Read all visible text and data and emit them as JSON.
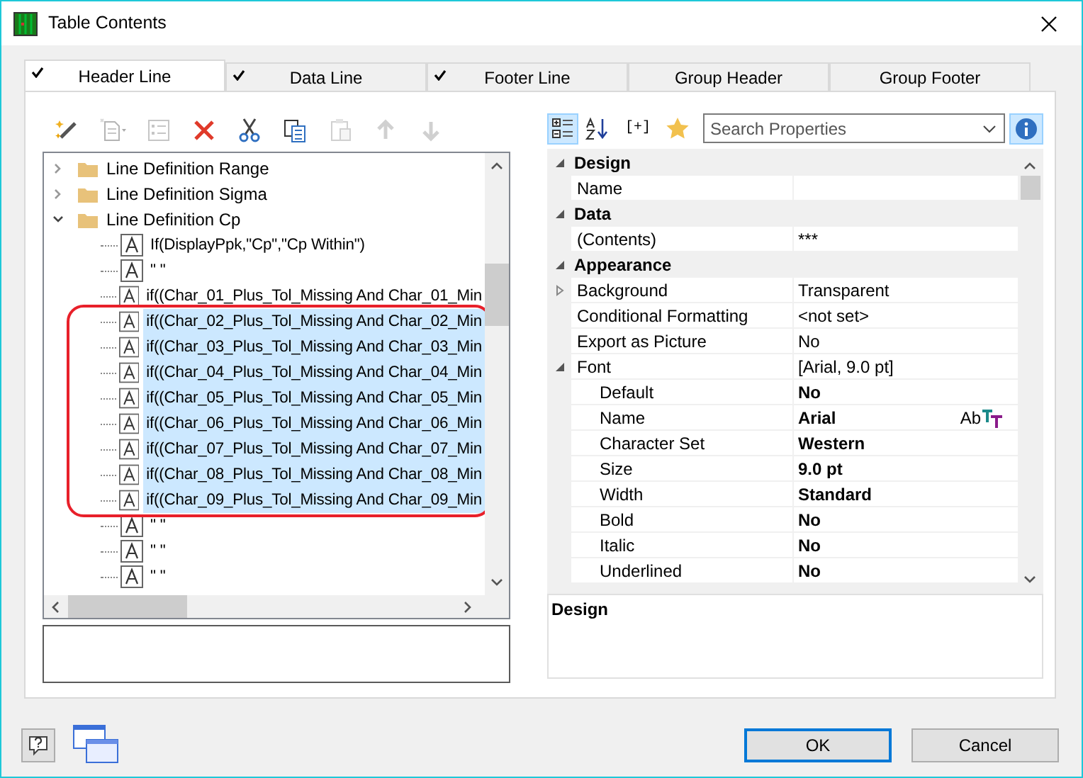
{
  "window": {
    "title": "Table Contents"
  },
  "tabs": [
    {
      "label": "Header Line",
      "checked": true,
      "selected": true
    },
    {
      "label": "Data Line",
      "checked": true,
      "selected": false
    },
    {
      "label": "Footer Line",
      "checked": true,
      "selected": false
    },
    {
      "label": "Group Header",
      "checked": false,
      "selected": false
    },
    {
      "label": "Group Footer",
      "checked": false,
      "selected": false
    }
  ],
  "tree_toolbar": [
    {
      "kind": "wand",
      "disabled": false
    },
    {
      "kind": "new",
      "disabled": true
    },
    {
      "kind": "properties",
      "disabled": true
    },
    {
      "kind": "delete",
      "disabled": false
    },
    {
      "kind": "cut",
      "disabled": false
    },
    {
      "kind": "copy",
      "disabled": false
    },
    {
      "kind": "paste",
      "disabled": true
    },
    {
      "kind": "up",
      "disabled": true
    },
    {
      "kind": "down",
      "disabled": true
    }
  ],
  "tree": [
    {
      "kind": "folder",
      "label": "Line Definition Range",
      "expanded": false,
      "selected": false
    },
    {
      "kind": "folder",
      "label": "Line Definition Sigma",
      "expanded": false,
      "selected": false
    },
    {
      "kind": "folder",
      "label": "Line Definition Cp",
      "expanded": true,
      "selected": false,
      "children": [
        {
          "kind": "text",
          "label": "If(DisplayPpk,\"Cp\",\"Cp Within\")",
          "selected": false
        },
        {
          "kind": "text",
          "label": "\" \"",
          "selected": false
        },
        {
          "kind": "text",
          "label": "if((Char_01_Plus_Tol_Missing And Char_01_Min",
          "selected": false
        },
        {
          "kind": "text",
          "label": "if((Char_02_Plus_Tol_Missing And Char_02_Min",
          "selected": true
        },
        {
          "kind": "text",
          "label": "if((Char_03_Plus_Tol_Missing And Char_03_Min",
          "selected": true
        },
        {
          "kind": "text",
          "label": "if((Char_04_Plus_Tol_Missing And Char_04_Min",
          "selected": true
        },
        {
          "kind": "text",
          "label": "if((Char_05_Plus_Tol_Missing And Char_05_Min",
          "selected": true
        },
        {
          "kind": "text",
          "label": "if((Char_06_Plus_Tol_Missing And Char_06_Min",
          "selected": true
        },
        {
          "kind": "text",
          "label": "if((Char_07_Plus_Tol_Missing And Char_07_Min",
          "selected": true
        },
        {
          "kind": "text",
          "label": "if((Char_08_Plus_Tol_Missing And Char_08_Min",
          "selected": true
        },
        {
          "kind": "text",
          "label": "if((Char_09_Plus_Tol_Missing And Char_09_Min",
          "selected": true
        },
        {
          "kind": "text",
          "label": "\" \"",
          "selected": false
        },
        {
          "kind": "text",
          "label": "\" \"",
          "selected": false
        },
        {
          "kind": "text",
          "label": "\" \"",
          "selected": false
        }
      ]
    }
  ],
  "property_toolbar": [
    {
      "kind": "categorized",
      "selected": true
    },
    {
      "kind": "alphabetical",
      "selected": false
    },
    {
      "kind": "expand",
      "label": "[+]",
      "selected": false
    },
    {
      "kind": "favorites",
      "selected": false
    }
  ],
  "search": {
    "placeholder": "Search Properties"
  },
  "info_button": {
    "selected": true
  },
  "properties": [
    {
      "category": "Design",
      "expanded": true,
      "items": [
        {
          "name": "Name",
          "value": ""
        }
      ]
    },
    {
      "category": "Data",
      "expanded": true,
      "items": [
        {
          "name": "(Contents)",
          "value": "***"
        }
      ]
    },
    {
      "category": "Appearance",
      "expanded": true,
      "items": [
        {
          "name": "Background",
          "value": "Transparent",
          "expanded": false
        },
        {
          "name": "Conditional Formatting",
          "value": "<not set>"
        },
        {
          "name": "Export as Picture",
          "value": "No"
        },
        {
          "name": "Font",
          "value": "[Arial, 9.0 pt]",
          "expanded": true,
          "children": [
            {
              "name": "Default",
              "value": "No",
              "modified": true
            },
            {
              "name": "Name",
              "value": "Arial",
              "modified": true,
              "font_picker": "Ab"
            },
            {
              "name": "Character Set",
              "value": "Western",
              "modified": true
            },
            {
              "name": "Size",
              "value": "9.0 pt",
              "modified": true
            },
            {
              "name": "Width",
              "value": "Standard",
              "modified": true
            },
            {
              "name": "Bold",
              "value": "No",
              "modified": true
            },
            {
              "name": "Italic",
              "value": "No",
              "modified": true
            },
            {
              "name": "Underlined",
              "value": "No",
              "modified": true
            }
          ]
        }
      ]
    }
  ],
  "description": {
    "title": "Design"
  },
  "buttons": [
    {
      "label": "OK",
      "default": true
    },
    {
      "label": "Cancel",
      "default": false
    }
  ]
}
